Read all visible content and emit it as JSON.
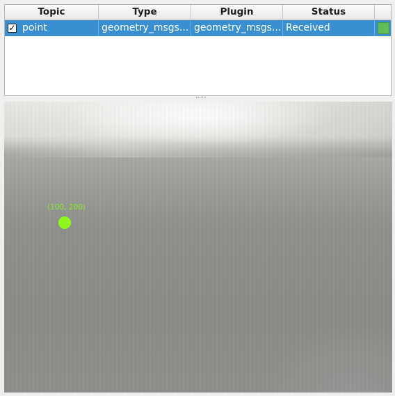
{
  "topics_table": {
    "headers": {
      "topic": "Topic",
      "type": "Type",
      "plugin": "Plugin",
      "status": "Status"
    },
    "rows": [
      {
        "checked": true,
        "topic": "point",
        "type": "geometry_msgs...",
        "plugin": "geometry_msgs...",
        "status": "Received",
        "status_color": "#5fbd55"
      }
    ],
    "selection_color": "#3a8fd1"
  },
  "image_view": {
    "point_label": "(100, 200)",
    "marker_color": "#8ef520"
  }
}
